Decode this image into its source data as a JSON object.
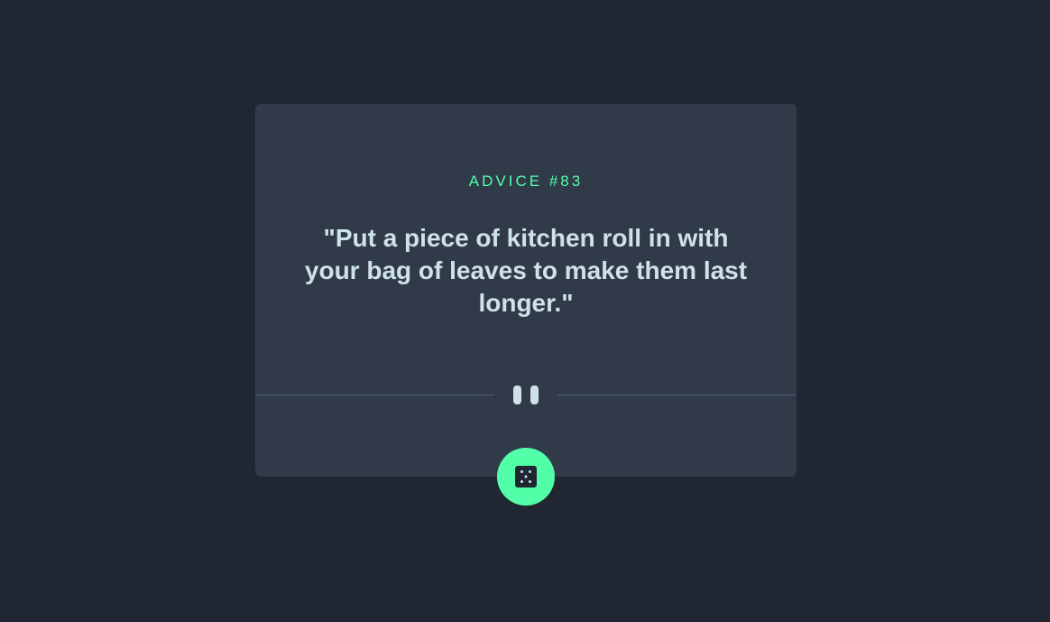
{
  "advice": {
    "id_label": "ADVICE #83",
    "text": "\"Put a piece of kitchen roll in with your bag of leaves to make them last longer.\""
  },
  "icons": {
    "divider": "pause-icon",
    "button": "dice-icon"
  },
  "colors": {
    "background": "#202632",
    "card": "#313a48",
    "accent": "#52ffa8",
    "text": "#cee3e9",
    "divider": "#4f5d74"
  }
}
